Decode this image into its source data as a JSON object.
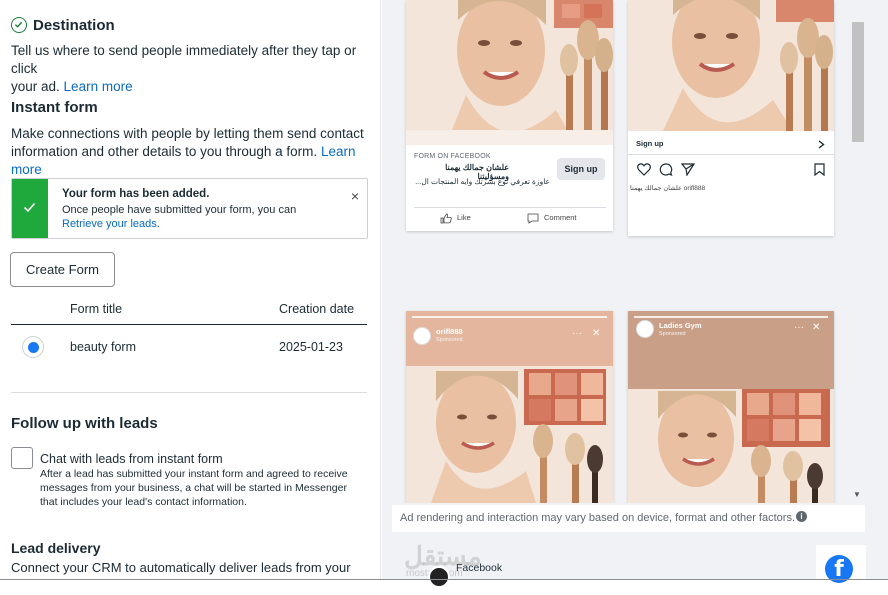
{
  "destination": {
    "title": "Destination",
    "desc": "Tell us where to send people immediately after they tap or click",
    "desc2": "your ad.",
    "learn_more": "Learn more"
  },
  "instant_form": {
    "title": "Instant form",
    "desc1": "Make connections with people by letting them send contact",
    "desc2": "information and other details to you through a form.",
    "learn": "Learn",
    "more": "more"
  },
  "alert": {
    "title": "Your form has been added.",
    "line1": "Once people have submitted your form, you can",
    "link": "Retrieve your leads",
    "link_suffix": ".",
    "close": "×"
  },
  "create_form_label": "Create Form",
  "table": {
    "headers": [
      "Form title",
      "Creation date"
    ],
    "rows": [
      {
        "title": "beauty form",
        "date": "2025-01-23",
        "selected": true
      }
    ]
  },
  "follow_up": {
    "title": "Follow up with leads",
    "checkbox_label": "Chat with leads from instant form",
    "help": [
      "After a lead has submitted your instant form and agreed to receive",
      "messages from your business, a chat will be started in Messenger",
      "that includes your lead's contact information."
    ]
  },
  "lead_delivery": {
    "title": "Lead delivery",
    "desc": "Connect your CRM to automatically deliver leads from your ads,"
  },
  "preview": {
    "fb_card": {
      "meta": "FORM ON FACEBOOK",
      "headline": "علشان جمالك يهمنا ومسؤليتنا",
      "body": "عاوزة تعرفي نوع بشرتك وايه المنتجات ال...",
      "cta": "Sign up",
      "like": "Like",
      "comment": "Comment"
    },
    "ig_card": {
      "cta": "Sign up",
      "caption_user": "orifl888",
      "caption_text": "علشان جمالك يهمنا"
    },
    "story1": {
      "name": "orifl888",
      "sub": "Sponsored"
    },
    "story2": {
      "name": "Ladies Gym",
      "sub": "Sponsored"
    },
    "notice": "Ad rendering and interaction may vary based on device, format and other factors.",
    "info": "i",
    "placement_label": "Facebook"
  },
  "watermark": {
    "arabic": "مستقل",
    "latin": "mostaql.com"
  },
  "colors": {
    "accent": "#0a6bc2",
    "success": "#1fa83b",
    "fb_blue": "#1877f2"
  },
  "icons": [
    "check-circle-icon",
    "checkmark-icon",
    "close-icon",
    "like-icon",
    "comment-icon",
    "heart-icon",
    "chat-bubble-icon",
    "send-icon",
    "bookmark-icon",
    "chevron-right-icon",
    "info-icon",
    "facebook-logo-icon"
  ]
}
